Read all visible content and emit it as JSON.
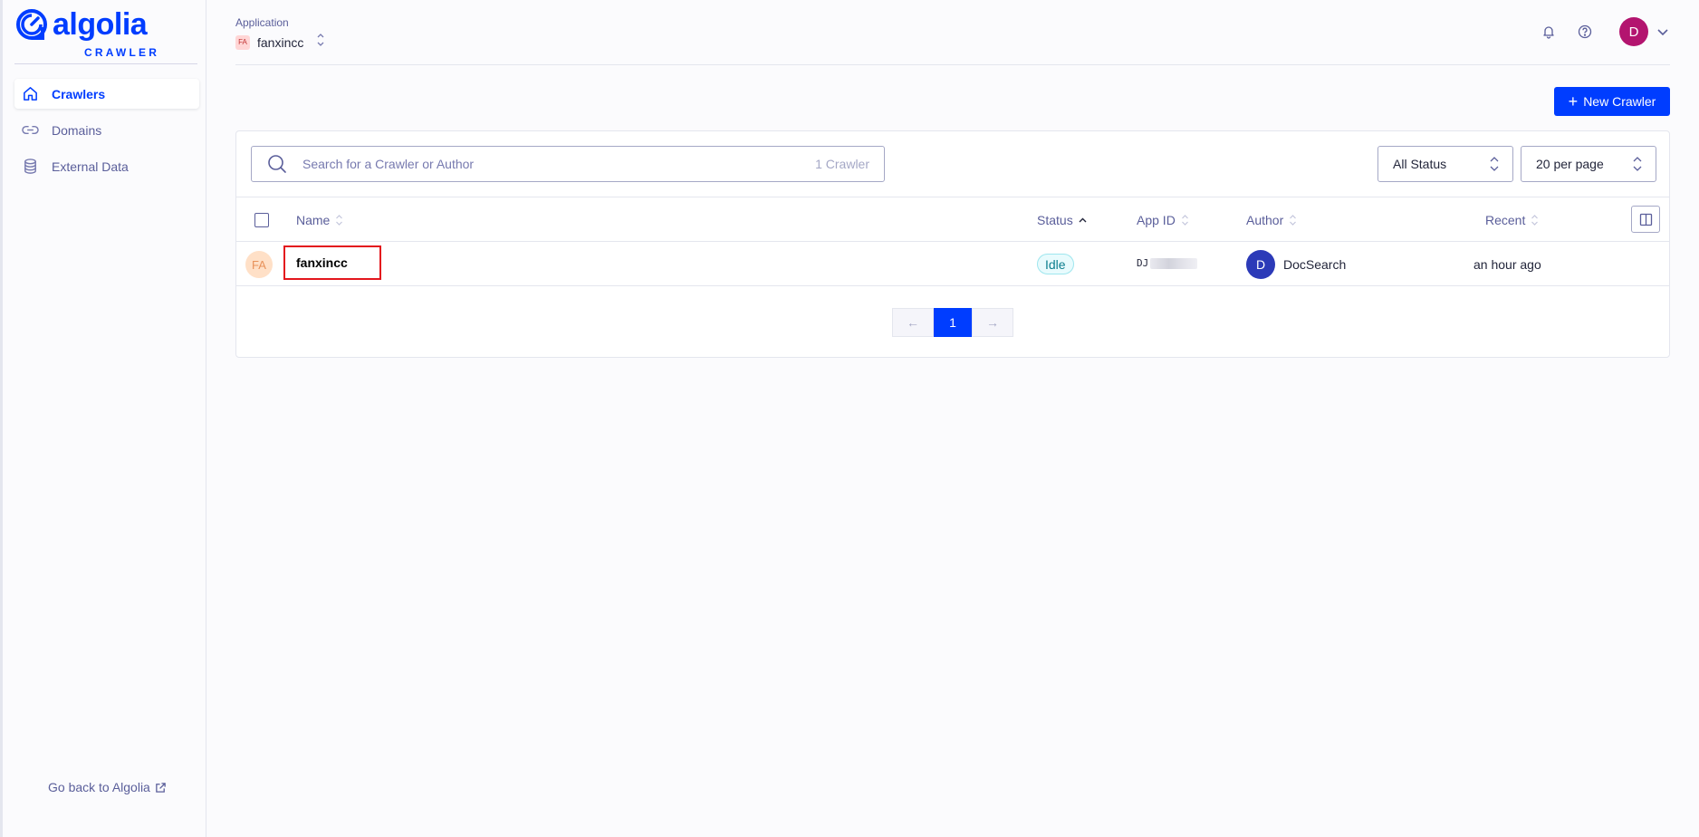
{
  "brand": {
    "word": "algolia",
    "product": "CRAWLER",
    "color": "#003dff"
  },
  "sidebar": {
    "items": [
      {
        "label": "Crawlers",
        "icon": "home-icon",
        "active": true
      },
      {
        "label": "Domains",
        "icon": "link-icon",
        "active": false
      },
      {
        "label": "External Data",
        "icon": "database-icon",
        "active": false
      }
    ],
    "back_link": "Go back to Algolia"
  },
  "header": {
    "application_label": "Application",
    "app_badge": "FA",
    "app_name": "fanxincc",
    "user_initial": "D"
  },
  "toolbar": {
    "new_crawler_label": "New Crawler"
  },
  "search": {
    "placeholder": "Search for a Crawler or Author",
    "count": "1 Crawler"
  },
  "filters": {
    "status_selected": "All Status",
    "per_page_selected": "20 per page"
  },
  "table": {
    "columns": {
      "name": "Name",
      "status": "Status",
      "app_id": "App ID",
      "author": "Author",
      "recent": "Recent"
    },
    "rows": [
      {
        "initials": "FA",
        "name": "fanxincc",
        "status": "Idle",
        "app_id": "DJ",
        "author_initial": "D",
        "author_name": "DocSearch",
        "recent": "an hour ago"
      }
    ]
  },
  "pagination": {
    "prev": "←",
    "current": "1",
    "next": "→"
  }
}
